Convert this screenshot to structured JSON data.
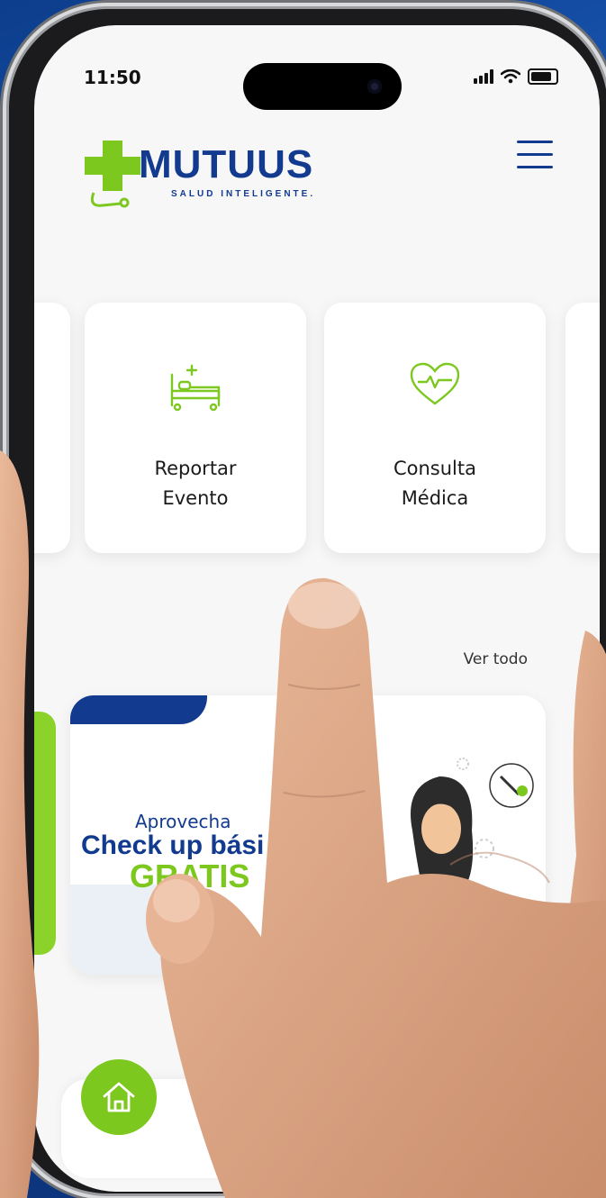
{
  "status_bar": {
    "time": "11:50"
  },
  "brand": {
    "name": "MUTUUS",
    "tagline": "SALUD INTELIGENTE."
  },
  "services": [
    {
      "label_line1": "Reportar",
      "label_line2": "Evento",
      "icon": "hospital-bed-icon"
    },
    {
      "label_line1": "Consulta",
      "label_line2": "Médica",
      "icon": "heart-pulse-icon"
    }
  ],
  "promotions": {
    "see_all": "Ver todo",
    "banner": {
      "pre": "Aprovecha",
      "main": "Check up bási",
      "highlight": "GRATIS"
    }
  },
  "nav": {
    "home_icon": "home-icon"
  },
  "colors": {
    "brand_blue": "#123a8e",
    "brand_green": "#7dc81e",
    "screen_bg": "#f7f7f7"
  }
}
